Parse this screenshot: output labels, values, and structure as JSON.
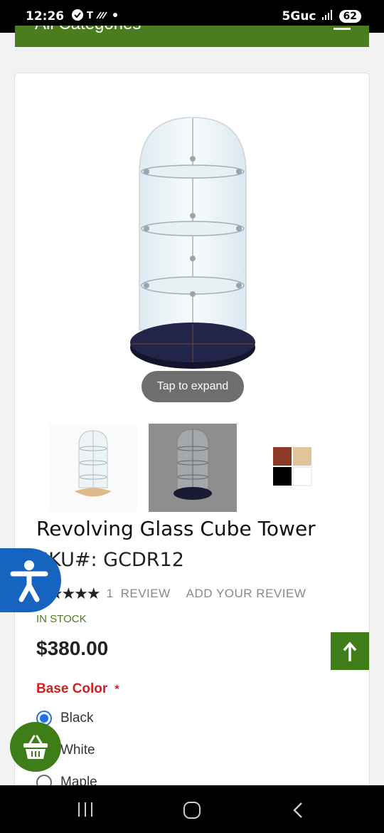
{
  "status_bar": {
    "time": "12:26",
    "network": "5Guc",
    "battery": "62"
  },
  "category_bar": {
    "label": "All Categories"
  },
  "gallery": {
    "tap_hint": "Tap to expand"
  },
  "product": {
    "title": "Revolving Glass Cube Tower",
    "sku": "SKU#: GCDR12",
    "stars": "★★★★★",
    "rating": 5,
    "review_count": "1",
    "review_label": "REVIEW",
    "add_review": "ADD YOUR REVIEW",
    "stock": "IN STOCK",
    "price": "$380.00"
  },
  "options": {
    "label": "Base Color",
    "required_mark": "*",
    "choices": [
      "Black",
      "White",
      "Maple"
    ],
    "selected": "Black"
  },
  "colors": {
    "brand_green": "#4a7d1e",
    "accessibility_blue": "#1565c0",
    "required_red": "#d0201f",
    "radio_blue": "#1a73e8",
    "swatch_cherry": "#8b3a26",
    "swatch_maple": "#e3c49a",
    "swatch_black": "#000000",
    "swatch_white": "#ffffff"
  },
  "icons": {
    "scroll_top": "arrow-up-icon",
    "cart": "basket-icon",
    "accessibility": "accessibility-person-icon",
    "menu": "hamburger-icon"
  }
}
